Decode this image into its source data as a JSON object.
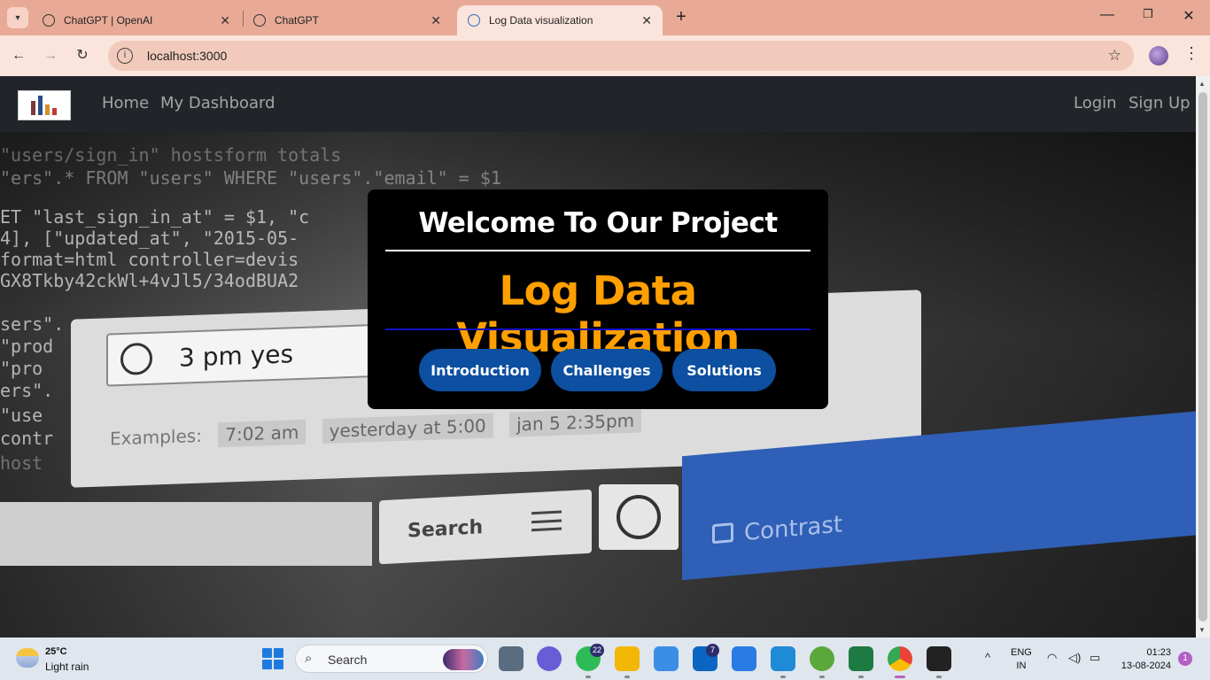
{
  "browser": {
    "tabs": [
      {
        "title": "ChatGPT | OpenAI",
        "active": false
      },
      {
        "title": "ChatGPT",
        "active": false
      },
      {
        "title": "Log Data visualization",
        "active": true
      }
    ],
    "url": "localhost:3000"
  },
  "navbar": {
    "links_left": [
      "Home",
      "My Dashboard"
    ],
    "links_right": [
      "Login",
      "Sign Up"
    ]
  },
  "hero_image": {
    "code_lines": [
      "\"users/sign_in\" hostsform totals",
      "\"ers\".* FROM \"users\" WHERE \"users\".\"email\" = $1",
      "ET \"last_sign_in_at\" = $1, \"c",
      "4], [\"updated_at\", \"2015-05-",
      "format=html controller=devis",
      "GX8Tkby42ckWl+4vJl5/34odBUA2",
      "sers\".",
      "\"prod",
      "\"pro",
      "ers\".",
      "\"use",
      "contr",
      "host"
    ],
    "time_input_value": "3 pm yes",
    "examples_label": "Examples:",
    "examples": [
      "7:02 am",
      "yesterday at 5:00",
      "jan 5 2:35pm"
    ],
    "search_label": "Search",
    "contrast_label": "Contrast"
  },
  "card": {
    "welcome": "Welcome To Our Project",
    "headline": "Log Data Visualization",
    "buttons": [
      "Introduction",
      "Challenges",
      "Solutions"
    ]
  },
  "taskbar": {
    "weather_temp": "25°C",
    "weather_desc": "Light rain",
    "search_label": "Search",
    "whatsapp_badge": "22",
    "linkedin_badge": "7",
    "lang_line1": "ENG",
    "lang_line2": "IN",
    "time": "01:23",
    "date": "13-08-2024",
    "notifications": "1"
  },
  "colors": {
    "tabbar": "#e8aa96",
    "navbar": "#212529",
    "headline": "#ff9f00",
    "card_button": "#0d4fa0",
    "divider_blue": "#1010c8"
  }
}
